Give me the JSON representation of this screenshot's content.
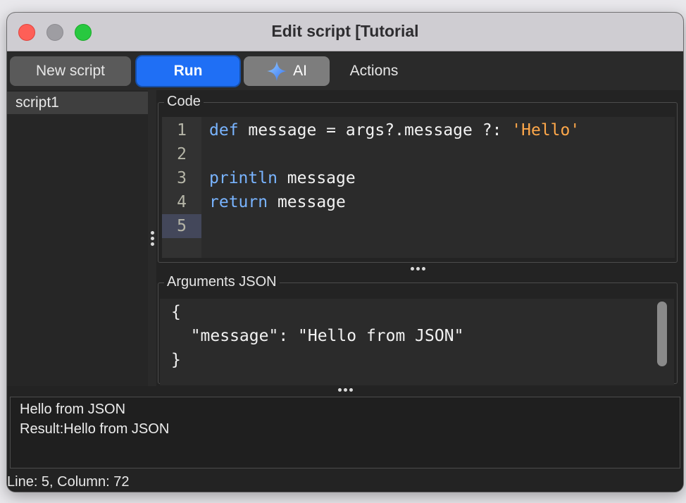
{
  "window": {
    "title": "Edit script [Tutorial"
  },
  "toolbar": {
    "new_script_label": "New script",
    "run_label": "Run",
    "ai_label": "AI",
    "ai_icon": "sparkle-icon",
    "actions_label": "Actions"
  },
  "sidebar": {
    "items": [
      {
        "label": "script1"
      }
    ]
  },
  "code_panel": {
    "label": "Code",
    "line_numbers": [
      "1",
      "2",
      "3",
      "4",
      "5"
    ],
    "active_line": 5,
    "lines": [
      [
        {
          "t": "def",
          "c": "keyword"
        },
        {
          "t": " message = args?.message ?: ",
          "c": "plain"
        },
        {
          "t": "'Hello'",
          "c": "string"
        }
      ],
      [],
      [
        {
          "t": "println",
          "c": "keyword"
        },
        {
          "t": " message",
          "c": "plain"
        }
      ],
      [
        {
          "t": "return",
          "c": "keyword"
        },
        {
          "t": " message",
          "c": "plain"
        }
      ],
      []
    ]
  },
  "arguments_panel": {
    "label": "Arguments JSON",
    "lines": [
      "{",
      "  \"message\": \"Hello from JSON\"",
      "}"
    ]
  },
  "output": {
    "lines": [
      "Hello from JSON",
      "Result:Hello from JSON"
    ]
  },
  "status_bar": {
    "text": "Line: 5, Column: 72"
  },
  "colors": {
    "run_button": "#1f6ff5",
    "keyword": "#79b4ff",
    "string": "#ffa84a",
    "active_line": "#43475a"
  }
}
